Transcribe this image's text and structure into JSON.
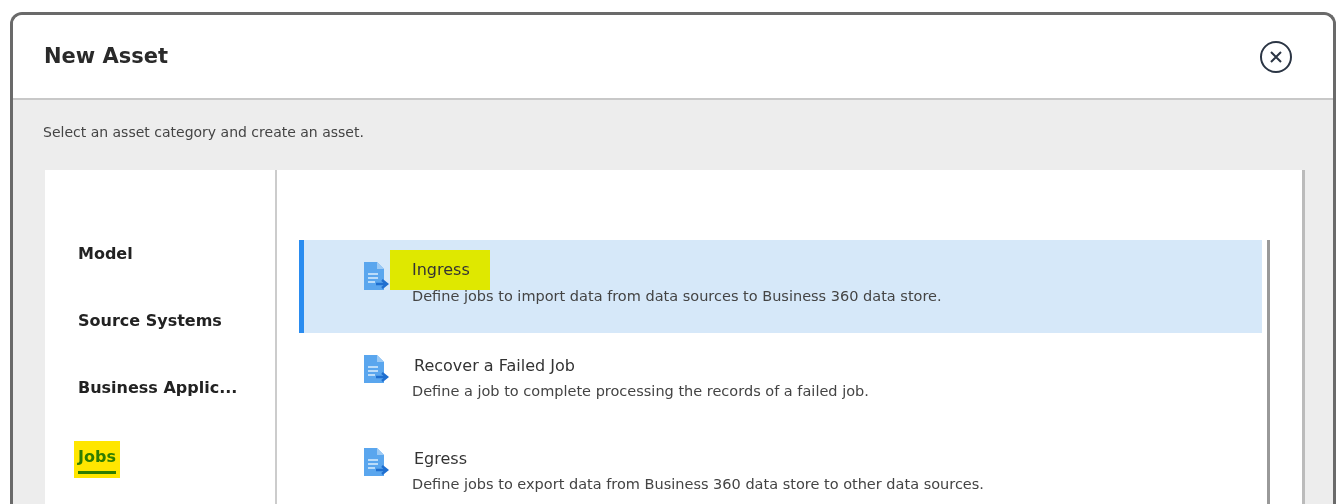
{
  "dialog": {
    "title": "New Asset",
    "subtitle": "Select an asset category and create an asset."
  },
  "categories": [
    {
      "label": "Model",
      "selected": false,
      "highlighted": false
    },
    {
      "label": "Source Systems",
      "selected": false,
      "highlighted": false
    },
    {
      "label": "Business Applic...",
      "selected": false,
      "highlighted": false
    },
    {
      "label": "Jobs",
      "selected": true,
      "highlighted": true
    }
  ],
  "assets": [
    {
      "title": "Ingress",
      "description": "Define jobs to import data from data sources to Business 360 data store.",
      "selected": true,
      "highlighted": true
    },
    {
      "title": "Recover a Failed Job",
      "description": "Define a job to complete processing the records of a failed job.",
      "selected": false,
      "highlighted": false
    },
    {
      "title": "Egress",
      "description": "Define jobs to export data from Business 360 data store to other data sources.",
      "selected": false,
      "highlighted": false
    }
  ]
}
